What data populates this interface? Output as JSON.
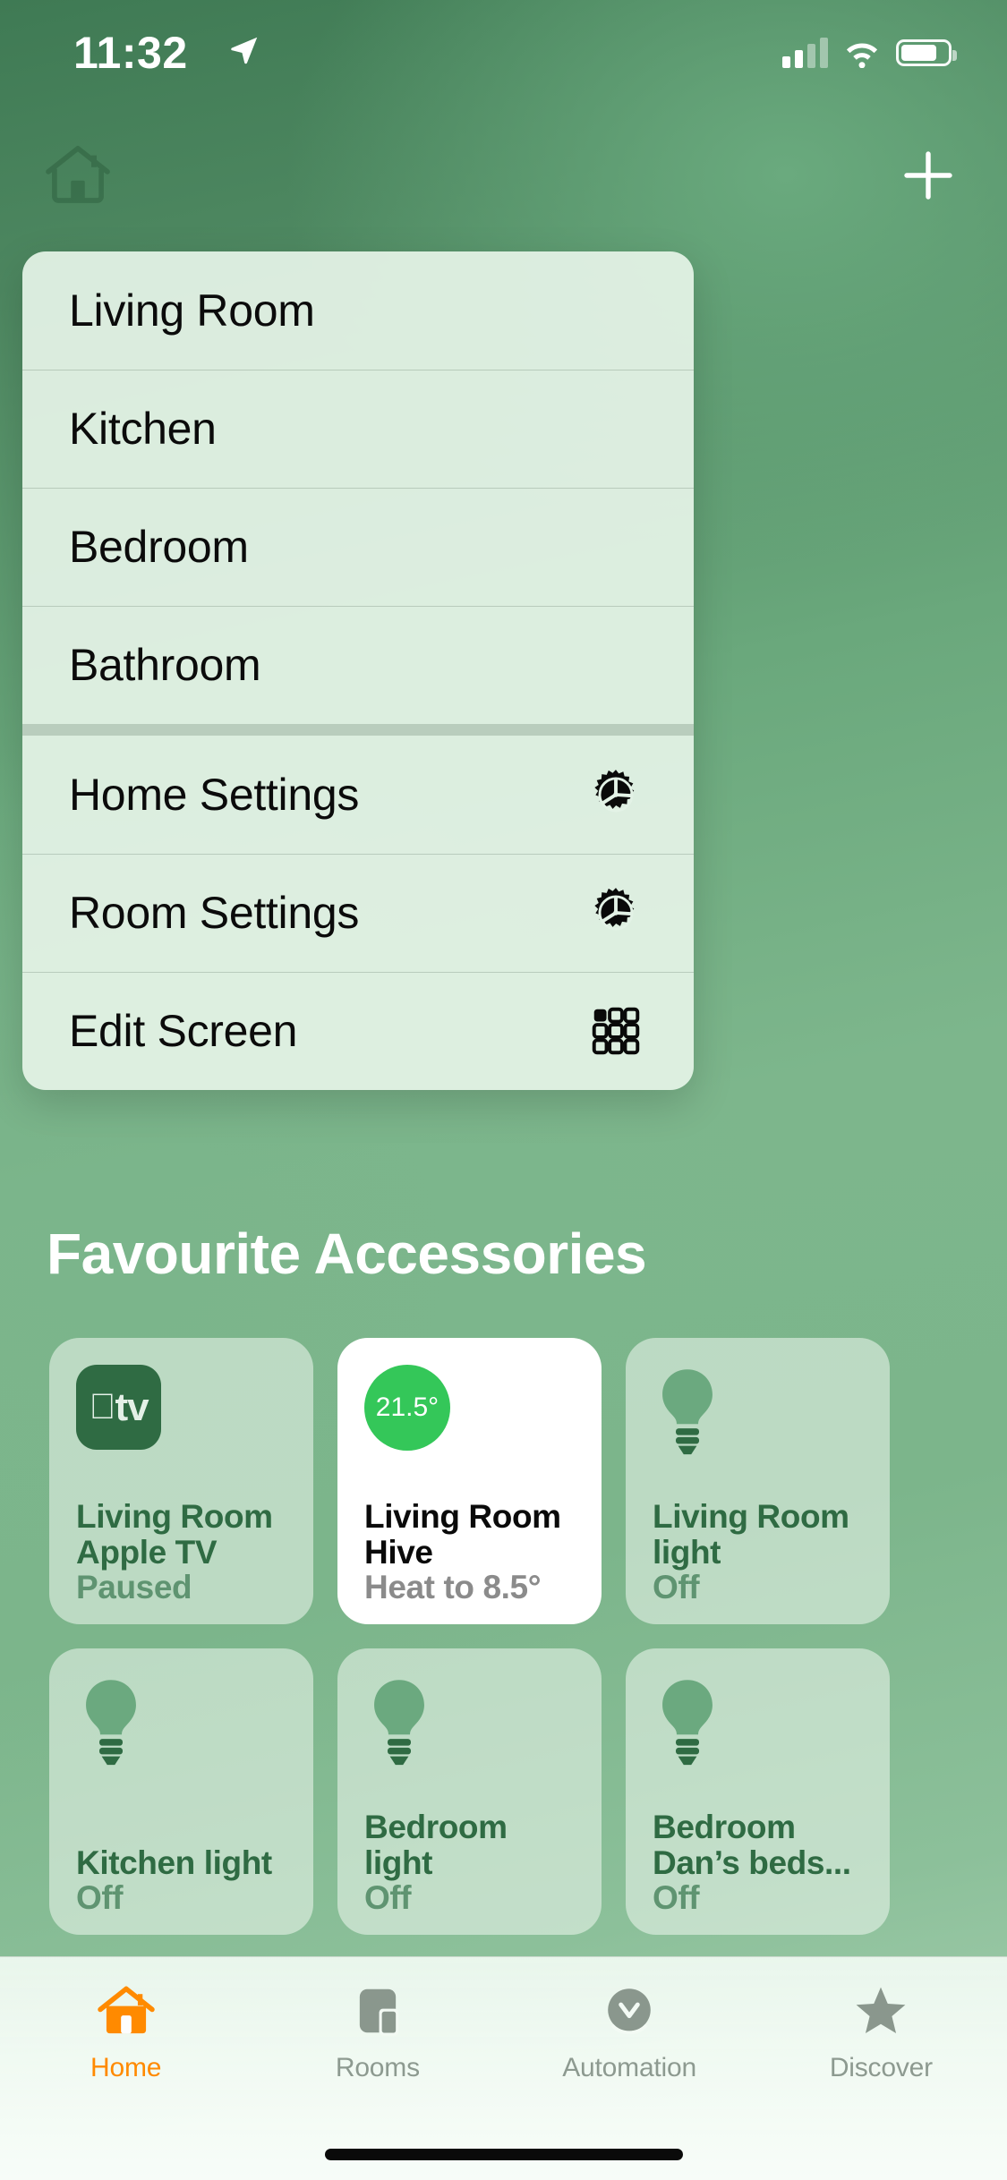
{
  "status_bar": {
    "time": "11:32",
    "location_icon": "location-arrow-icon",
    "cellular_icon": "cellular-bars-icon",
    "wifi_icon": "wifi-icon",
    "battery_icon": "battery-icon"
  },
  "navbar": {
    "home_icon": "house-icon",
    "add_icon": "plus-icon"
  },
  "context_menu": {
    "items": [
      {
        "label": "Living Room",
        "icon": null
      },
      {
        "label": "Kitchen",
        "icon": null
      },
      {
        "label": "Bedroom",
        "icon": null
      },
      {
        "label": "Bathroom",
        "icon": null
      },
      {
        "label": "Home Settings",
        "icon": "gear-icon"
      },
      {
        "label": "Room Settings",
        "icon": "gear-icon"
      },
      {
        "label": "Edit Screen",
        "icon": "grid-icon"
      }
    ]
  },
  "favourites": {
    "title": "Favourite Accessories",
    "accessories": [
      {
        "name": "Living Room Apple TV",
        "state": "Paused",
        "icon": "apple-tv-icon",
        "icon_label": "tv",
        "active": false
      },
      {
        "name": "Living Room Hive",
        "state": "Heat to 8.5°",
        "icon": "thermostat-icon",
        "temperature": "21.5°",
        "active": true
      },
      {
        "name": "Living Room light",
        "state": "Off",
        "icon": "lightbulb-icon",
        "active": false
      },
      {
        "name": "Kitchen light",
        "state": "Off",
        "icon": "lightbulb-icon",
        "active": false
      },
      {
        "name": "Bedroom light",
        "state": "Off",
        "icon": "lightbulb-icon",
        "active": false
      },
      {
        "name": "Bedroom Dan’s beds...",
        "state": "Off",
        "icon": "lightbulb-icon",
        "active": false
      }
    ]
  },
  "tab_bar": {
    "tabs": [
      {
        "label": "Home",
        "icon": "house-icon",
        "active": true
      },
      {
        "label": "Rooms",
        "icon": "rooms-icon",
        "active": false
      },
      {
        "label": "Automation",
        "icon": "clock-check-icon",
        "active": false
      },
      {
        "label": "Discover",
        "icon": "star-icon",
        "active": false
      }
    ]
  },
  "colors": {
    "accent": "#ff8a00",
    "card_on_background": "#ffffff",
    "temperature_badge": "#34c759",
    "card_text": "#2f6b43",
    "menu_background": "#e3f2e6"
  }
}
